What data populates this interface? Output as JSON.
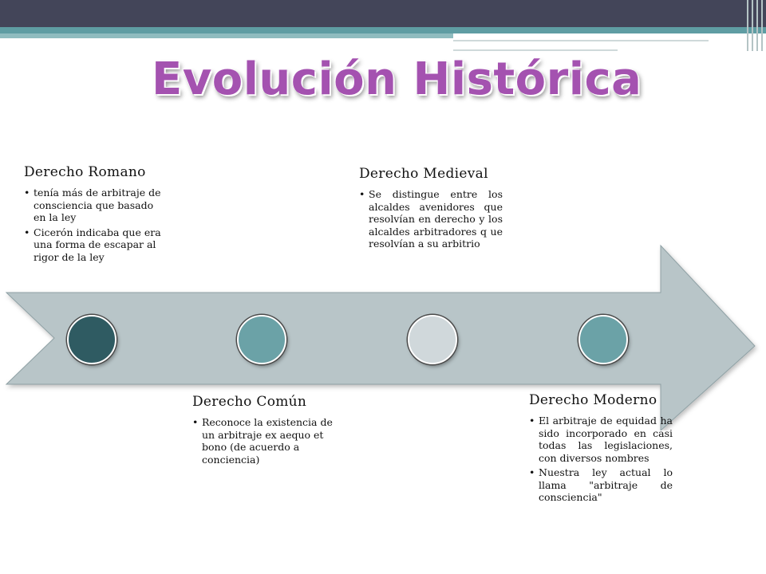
{
  "title": "Evolución Histórica",
  "colors": {
    "title": "#a452b0",
    "arrow_fill": "#b8c5c8",
    "header_bar": "#434559",
    "header_teal": "#5f9da3",
    "dot_dark": "#2f5b62",
    "dot_teal": "#6ba2a7",
    "dot_light": "#d0d8db"
  },
  "eras": {
    "romano": {
      "heading": "Derecho Romano",
      "bullets": [
        "tenía más de arbitraje de consciencia  que basado en la ley",
        "Cicerón indicaba que era una forma de escapar al rigor de la ley"
      ]
    },
    "comun": {
      "heading": "Derecho Común",
      "bullets": [
        "Reconoce la existencia de un arbitraje ex aequo et bono (de acuerdo a conciencia)"
      ]
    },
    "medieval": {
      "heading": "Derecho Medieval",
      "bullets": [
        "Se distingue entre los alcaldes avenidores que resolvían en derecho y los alcaldes arbitradores q ue resolvían a su arbitrio"
      ]
    },
    "moderno": {
      "heading": "Derecho Moderno",
      "bullets": [
        "El arbitraje de equidad ha sido incorporado en casi todas las legislaciones, con diversos nombres",
        "Nuestra ley actual lo llama \"arbitraje de consciencia\""
      ]
    }
  }
}
